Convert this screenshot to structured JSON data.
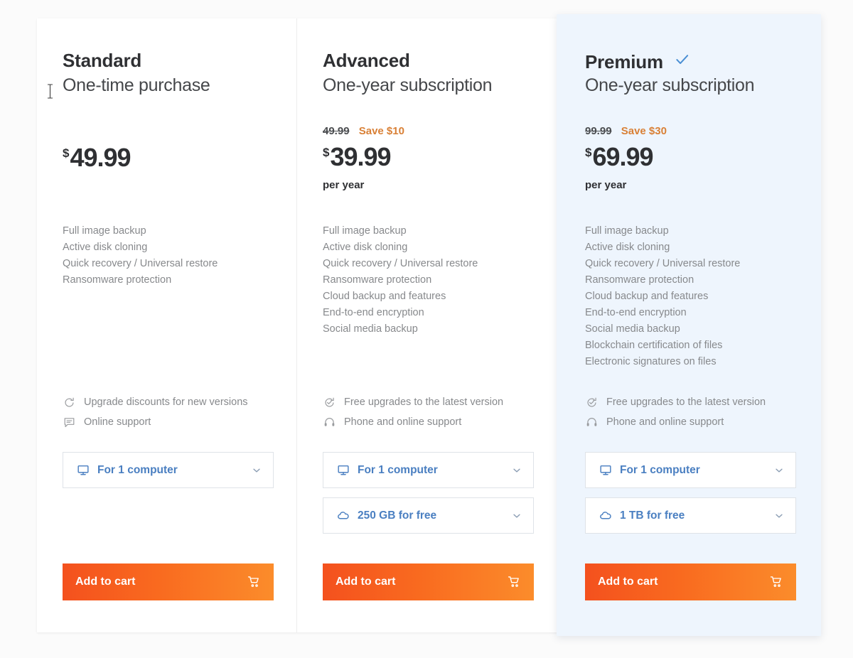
{
  "theme": {
    "page_background": "#fbfbfb",
    "card_background": "#ffffff",
    "highlight_background": "#eef5fd",
    "accent_blue": "#4a7fc1",
    "save_orange": "#d98036",
    "cart_gradient_from": "#f4511e",
    "cart_gradient_to": "#fb8c2b",
    "feature_text": "#87898c",
    "heading_text": "#2f3033"
  },
  "plans": [
    {
      "name": "Standard",
      "recommended": false,
      "subtitle": "One-time purchase",
      "old_price": null,
      "save_label": null,
      "currency": "$",
      "price": "49.99",
      "period": null,
      "features": [
        "Full image backup",
        "Active disk cloning",
        "Quick recovery / Universal restore",
        "Ransomware protection"
      ],
      "perks": [
        {
          "icon": "refresh-arrow-icon",
          "label": "Upgrade discounts for new versions"
        },
        {
          "icon": "chat-bubble-icon",
          "label": "Online support"
        }
      ],
      "selects": [
        {
          "icon": "desktop-computer-icon",
          "label": "For 1 computer"
        }
      ],
      "cta": {
        "label": "Add to cart",
        "icon": "shopping-cart-icon"
      }
    },
    {
      "name": "Advanced",
      "recommended": false,
      "subtitle": "One-year subscription",
      "old_price": "49.99",
      "save_label": "Save $10",
      "currency": "$",
      "price": "39.99",
      "period": "per year",
      "features": [
        "Full image backup",
        "Active disk cloning",
        "Quick recovery / Universal restore",
        "Ransomware protection",
        "Cloud backup and features",
        "End-to-end encryption",
        "Social media backup"
      ],
      "perks": [
        {
          "icon": "refresh-check-icon",
          "label": "Free upgrades to the latest version"
        },
        {
          "icon": "headset-icon",
          "label": "Phone and online support"
        }
      ],
      "selects": [
        {
          "icon": "desktop-computer-icon",
          "label": "For 1 computer"
        },
        {
          "icon": "cloud-icon",
          "label": "250 GB for free"
        }
      ],
      "cta": {
        "label": "Add to cart",
        "icon": "shopping-cart-icon"
      }
    },
    {
      "name": "Premium",
      "recommended": true,
      "recommended_icon": "checkmark-icon",
      "subtitle": "One-year subscription",
      "old_price": "99.99",
      "save_label": "Save $30",
      "currency": "$",
      "price": "69.99",
      "period": "per year",
      "features": [
        "Full image backup",
        "Active disk cloning",
        "Quick recovery / Universal restore",
        "Ransomware protection",
        "Cloud backup and features",
        "End-to-end encryption",
        "Social media backup",
        "Blockchain certification of files",
        "Electronic signatures on files"
      ],
      "perks": [
        {
          "icon": "refresh-check-icon",
          "label": "Free upgrades to the latest version"
        },
        {
          "icon": "headset-icon",
          "label": "Phone and online support"
        }
      ],
      "selects": [
        {
          "icon": "desktop-computer-icon",
          "label": "For 1 computer"
        },
        {
          "icon": "cloud-icon",
          "label": "1 TB for free"
        }
      ],
      "cta": {
        "label": "Add to cart",
        "icon": "shopping-cart-icon"
      }
    }
  ]
}
